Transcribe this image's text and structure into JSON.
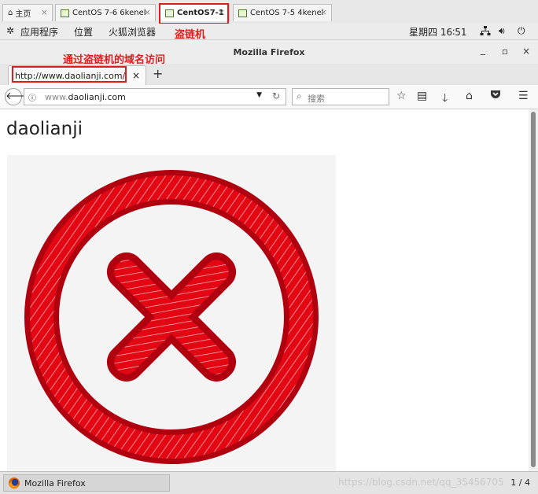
{
  "vm_tabs": [
    {
      "label": "主页",
      "close": "×"
    },
    {
      "label": "CentOS 7-6 6kenel",
      "close": "×"
    },
    {
      "label": "CentOS7-1",
      "close": "×",
      "active": true
    },
    {
      "label": "CentOS 7-5 4kenel",
      "close": "×"
    }
  ],
  "annotations": {
    "vm_label": "盗链机",
    "url_label": "通过盗链机的域名访问"
  },
  "panel": {
    "apps": "应用程序",
    "places": "位置",
    "browser": "火狐浏览器",
    "clock": "星期四 16∶51"
  },
  "window": {
    "title": "Mozilla Firefox",
    "minimize": "_",
    "maximize": "▫",
    "close": "×"
  },
  "tab": {
    "label": "http://www.daolianji.com/",
    "close": "×",
    "new": "+"
  },
  "navbar": {
    "url_prefix": "www.",
    "url_domain": "daolianji.com",
    "search_placeholder": "搜索"
  },
  "page": {
    "heading": "daolianji"
  },
  "taskbar": {
    "item": "Mozilla Firefox",
    "pager": "1 / 4"
  },
  "watermark": "https://blog.csdn.net/qq_35456705",
  "colors": {
    "annotation": "#e21c1c",
    "error_red": "#e30613",
    "error_dark": "#b00010"
  }
}
